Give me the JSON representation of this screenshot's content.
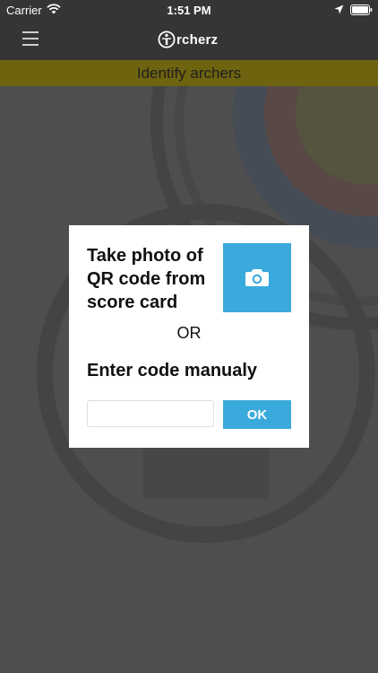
{
  "status_bar": {
    "carrier": "Carrier",
    "time": "1:51 PM",
    "icons": [
      "wifi-icon",
      "location-icon",
      "battery-icon"
    ]
  },
  "nav": {
    "menu_icon": "hamburger-menu-icon",
    "logo_text": "rcherz"
  },
  "banner": {
    "title": "Identify archers"
  },
  "modal": {
    "photo_instruction": "Take photo of QR code from score card",
    "camera_icon": "camera-icon",
    "or_label": "OR",
    "manual_label": "Enter code manualy",
    "code_input": {
      "value": "",
      "placeholder": ""
    },
    "ok_label": "OK"
  },
  "colors": {
    "accent": "#3aa9dc",
    "banner": "#6e6410",
    "navbar": "#353535",
    "overlay_background": "#4e4e4e"
  }
}
